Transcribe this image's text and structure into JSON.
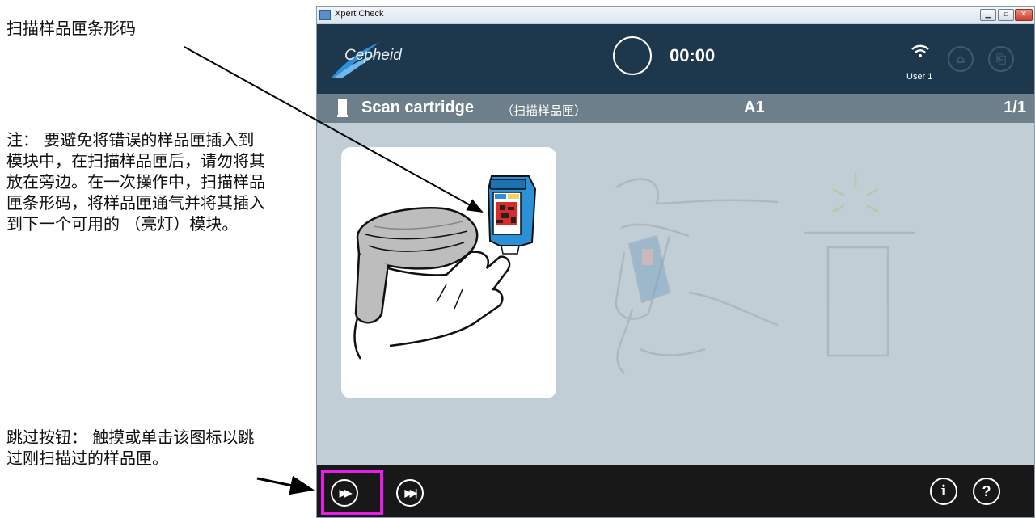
{
  "annotations": {
    "scan_barcode": "扫描样品匣条形码",
    "note": "注： 要避免将错误的样品匣插入到模块中，在扫描样品匣后，请勿将其放在旁边。在一次操作中，扫描样品匣条形码，将样品匣通气并将其插入到下一个可用的 （亮灯）模块。",
    "skip_button": "跳过按钮： 触摸或单击该图标以跳过刚扫描过的样品匣。"
  },
  "window": {
    "title": "Xpert Check"
  },
  "header": {
    "logo_text": "Cepheid",
    "timer": "00:00",
    "user": "User 1",
    "icons": [
      "wifi-icon",
      "home-icon",
      "logout-icon"
    ]
  },
  "step": {
    "title": "Scan cartridge",
    "subtitle": "（扫描样品匣）",
    "module": "A1",
    "page": "1/1"
  },
  "bottom": {
    "skip_icon": "▶▶",
    "skip_all_icon": "▶▶|",
    "info": "i",
    "help": "?"
  },
  "colors": {
    "header": "#1d384d",
    "stepbar": "#6d7f8b",
    "content": "#c1ced5",
    "bottombar": "#181818",
    "highlight": "#e81be8",
    "cartridge": "#2b90d6"
  }
}
